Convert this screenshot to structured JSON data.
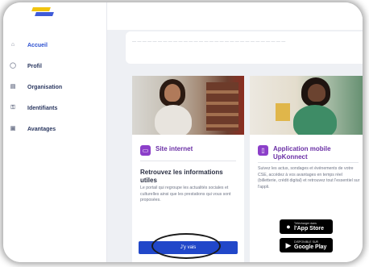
{
  "sidebar": {
    "items": [
      {
        "label": "Accueil",
        "icon": "home-icon"
      },
      {
        "label": "Profil",
        "icon": "user-icon"
      },
      {
        "label": "Organisation",
        "icon": "building-icon"
      },
      {
        "label": "Identifiants",
        "icon": "key-icon"
      },
      {
        "label": "Avantages",
        "icon": "gift-icon"
      }
    ]
  },
  "colors": {
    "accent": "#2147c9",
    "card_title": "#6a2fa5",
    "badge": "#8c3fc9"
  },
  "cards": [
    {
      "title": "Site internet",
      "subtitle": "Retrouvez les informations utiles",
      "description": "Le portail qui regroupe les actualités sociales et culturelles ainsi que les prestations qui vous sont proposées.",
      "button": "J'y vais"
    },
    {
      "title": "Application mobile UpKonnect",
      "description": "Suivez les actus, sondages et événements de votre CSE, accédez à vos avantages en temps réel (billetterie, crédit digital) et retrouvez tout l'essentiel sur l'appli.",
      "app_store": {
        "small": "Télécharger dans",
        "big": "l'App Store"
      },
      "google_play": {
        "small": "DISPONIBLE SUR",
        "big": "Google Play"
      }
    }
  ]
}
